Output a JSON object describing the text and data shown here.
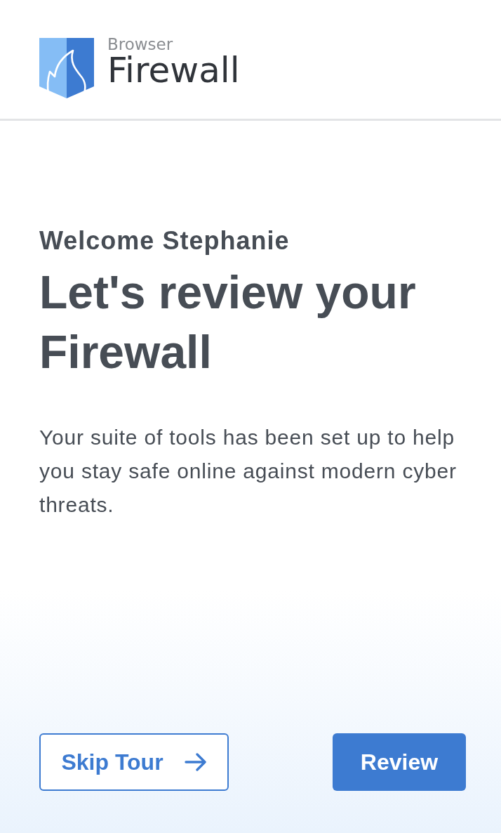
{
  "header": {
    "logo": {
      "subtitle": "Browser",
      "title": "Firewall"
    }
  },
  "intro": {
    "greeting": "Welcome Stephanie",
    "heading": "Let's review your Firewall",
    "body": "Your suite of tools has been set up to help you stay safe online against modern cyber threats."
  },
  "actions": [
    {
      "label": "Skip Tour",
      "kind": "secondary"
    },
    {
      "label": "Review",
      "kind": "primary"
    }
  ]
}
